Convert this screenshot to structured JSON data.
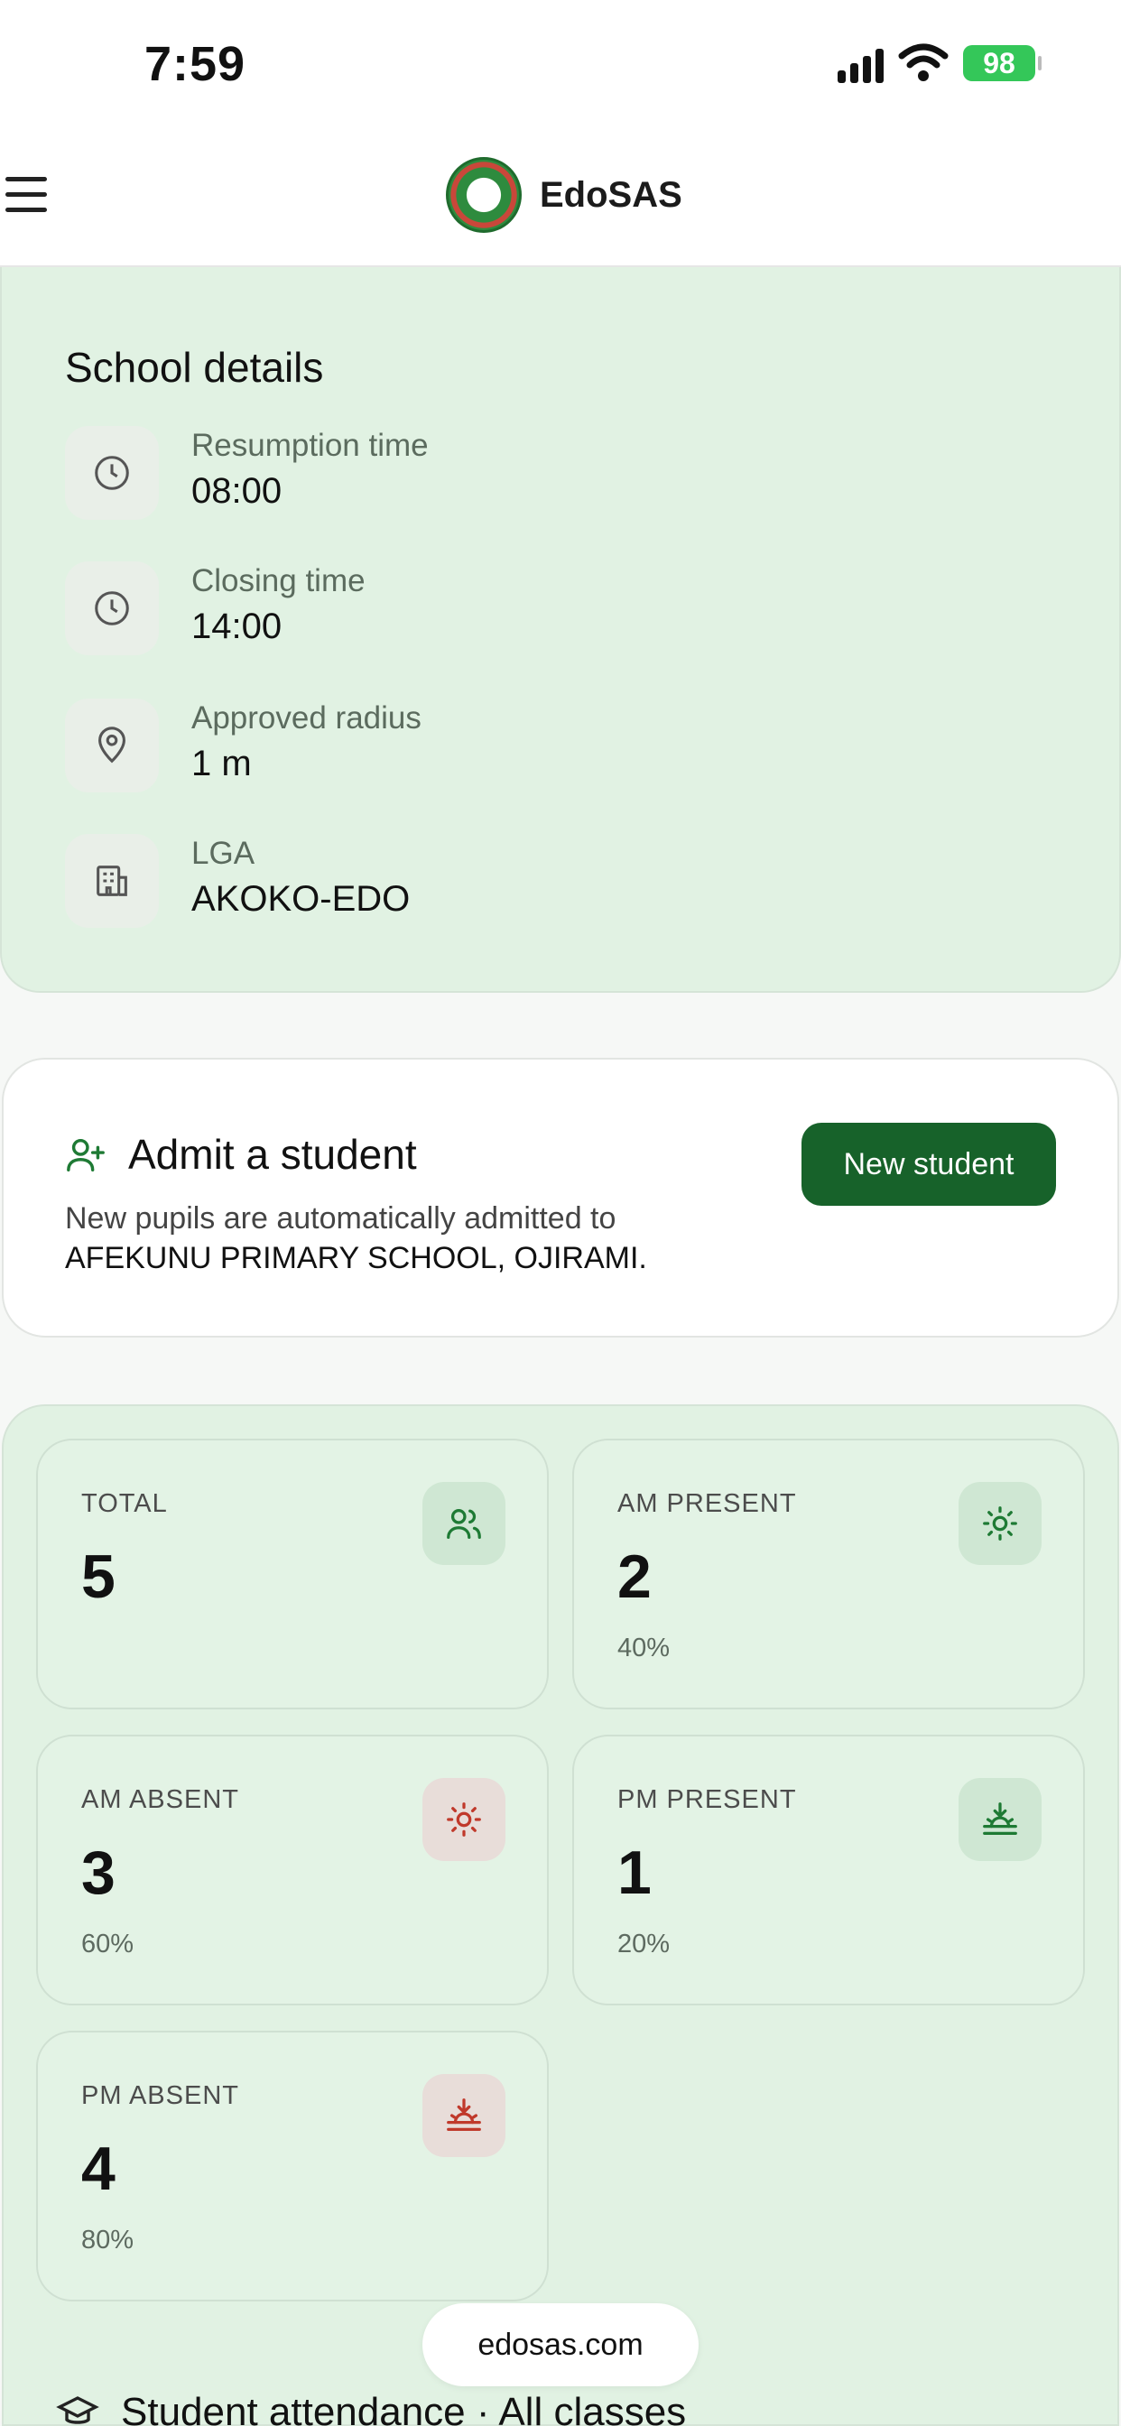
{
  "status_bar": {
    "time": "7:59",
    "battery": "98"
  },
  "header": {
    "app_name": "EdoSAS"
  },
  "school_details": {
    "title": "School details",
    "items": [
      {
        "label": "Resumption time",
        "value": "08:00",
        "icon": "clock-icon"
      },
      {
        "label": "Closing time",
        "value": "14:00",
        "icon": "clock-icon"
      },
      {
        "label": "Approved radius",
        "value": "1 m",
        "icon": "map-pin-icon"
      },
      {
        "label": "LGA",
        "value": "AKOKO-EDO",
        "icon": "building-icon"
      }
    ]
  },
  "admit": {
    "title": "Admit a student",
    "description": "New pupils are automatically admitted to",
    "school_name": "AFEKUNU PRIMARY SCHOOL, OJIRAMI.",
    "button_label": "New student"
  },
  "stats": [
    {
      "label": "TOTAL",
      "value": "5",
      "percent": "",
      "icon": "users-icon"
    },
    {
      "label": "AM PRESENT",
      "value": "2",
      "percent": "40%",
      "icon": "sun-icon"
    },
    {
      "label": "AM ABSENT",
      "value": "3",
      "percent": "60%",
      "icon": "sun-icon"
    },
    {
      "label": "PM PRESENT",
      "value": "1",
      "percent": "20%",
      "icon": "sunset-icon"
    },
    {
      "label": "PM ABSENT",
      "value": "4",
      "percent": "80%",
      "icon": "sunset-icon"
    }
  ],
  "footer": {
    "site": "edosas.com",
    "attendance_title": "Student attendance · All classes"
  },
  "colors": {
    "accent": "#17622a",
    "card_bg": "#e1f2e3",
    "absent_icon": "#c0392b",
    "present_icon": "#1e7a34"
  }
}
